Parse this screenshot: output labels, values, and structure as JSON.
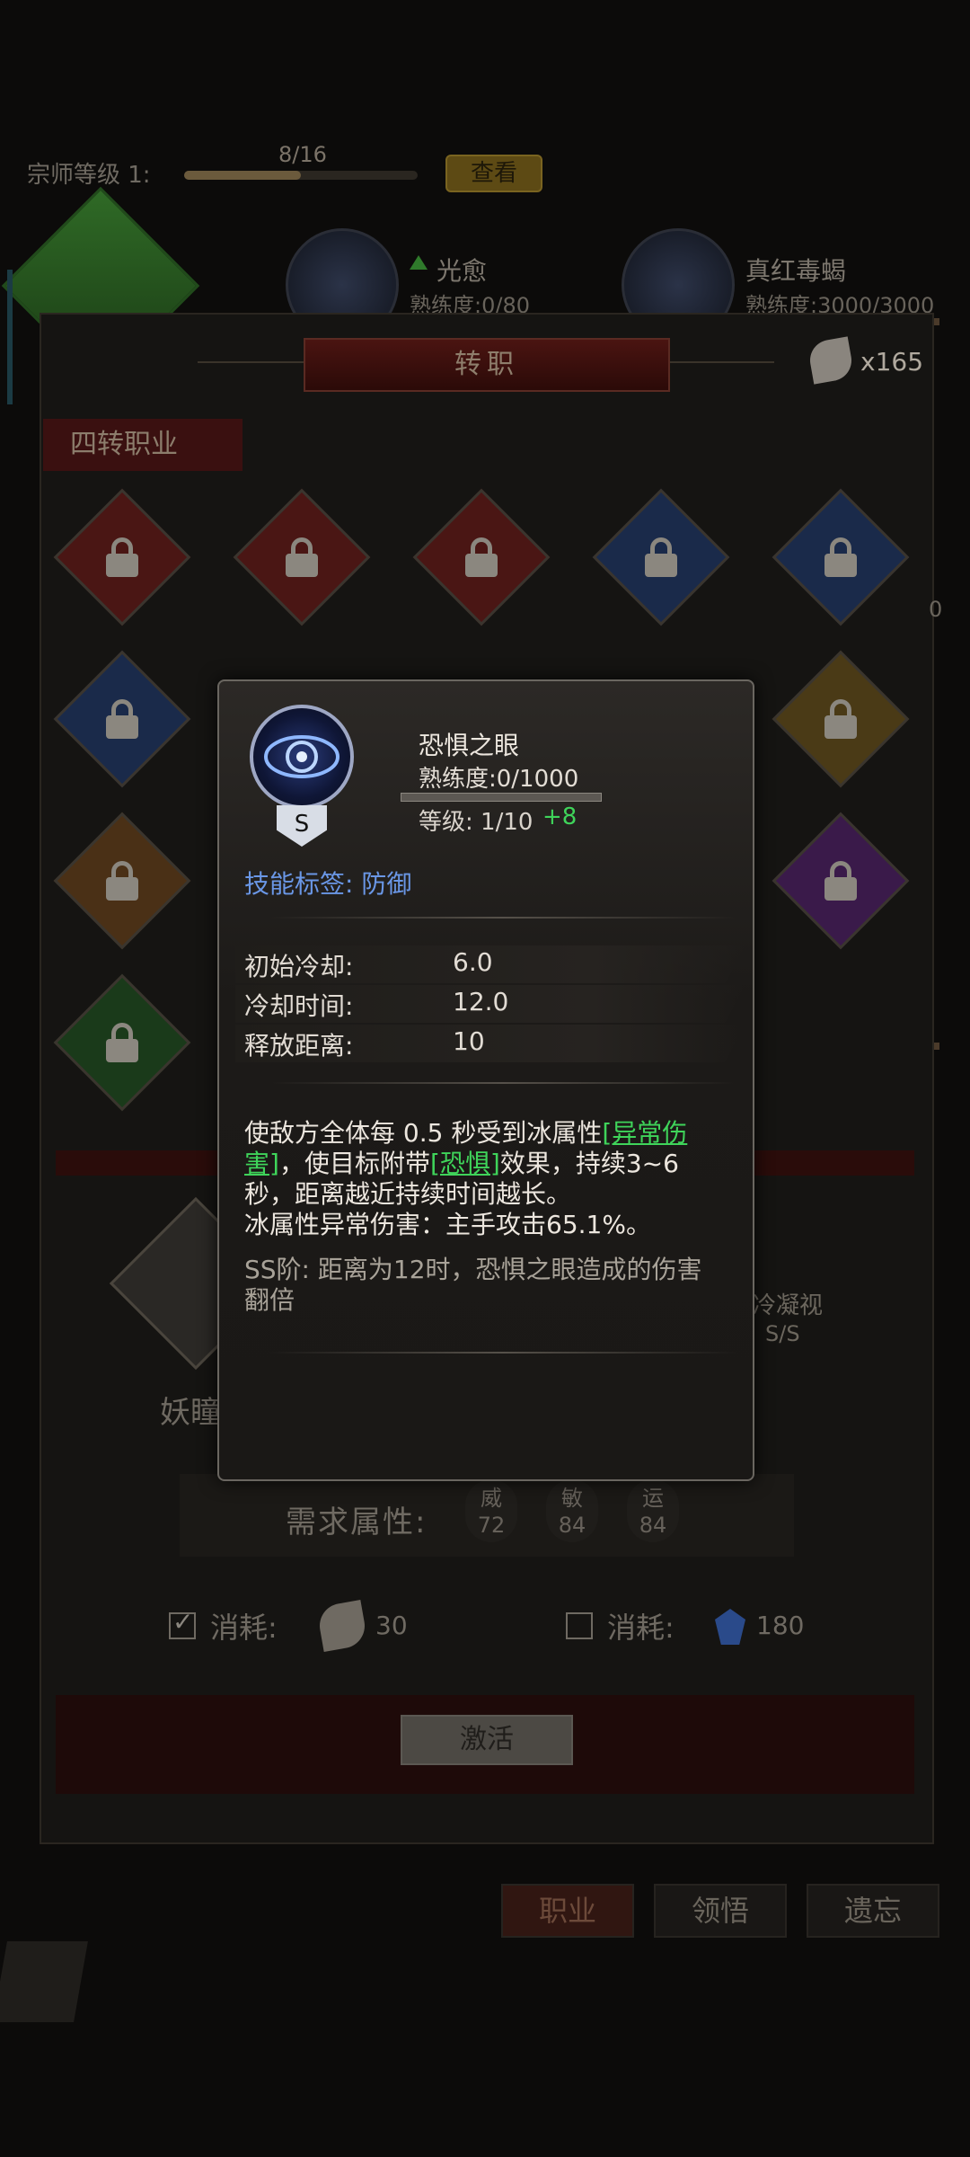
{
  "master": {
    "label": "宗师等级 1:",
    "progress_text": "8/16",
    "progress": 0.5,
    "view_button": "查看"
  },
  "top_skills": [
    {
      "name": "光愈",
      "proficiency": "熟练度:0/80"
    },
    {
      "name": "真红毒蝎",
      "proficiency": "熟练度:3000/3000"
    }
  ],
  "panel": {
    "title": "转职",
    "leaf_count": "x165",
    "section_tab": "四转职业",
    "right_hint": "0"
  },
  "popup": {
    "skill_name": "恐惧之眼",
    "proficiency": "熟练度:0/1000",
    "rank": "S",
    "level": "等级: 1/10",
    "level_bonus": "+8",
    "tag_label": "技能标签:",
    "tag_value": "防御",
    "attributes": [
      {
        "label": "初始冷却:",
        "value": "6.0"
      },
      {
        "label": "冷却时间:",
        "value": "12.0"
      },
      {
        "label": "释放距离:",
        "value": "10"
      }
    ],
    "desc_part1": "使敌方全体每 0.5 秒受到冰属性",
    "desc_hl1": "[异常伤害]",
    "desc_part2": "，使目标附带",
    "desc_hl2": "[恐惧]",
    "desc_part3": "效果，持续3~6 秒，距离越近持续时间越长。",
    "desc_line2": "冰属性异常伤害：主手攻击65.1%。",
    "ss_text": "SS阶: 距离为12时，恐惧之眼造成的伤害翻倍"
  },
  "lower": {
    "name_under": "妖瞳",
    "cold_label": "冷凝视",
    "ss_label": "S/S",
    "req_label": "需求属性:",
    "stats": [
      {
        "name": "威",
        "value": "72"
      },
      {
        "name": "敏",
        "value": "84"
      },
      {
        "name": "运",
        "value": "84"
      }
    ],
    "cost_label": "消耗:",
    "cost1": "30",
    "cost2": "180",
    "cost1_checked": true,
    "cost2_checked": false,
    "activate": "激活"
  },
  "bottom_tabs": [
    {
      "label": "职业",
      "active": true
    },
    {
      "label": "领悟",
      "active": false
    },
    {
      "label": "遗忘",
      "active": false
    }
  ],
  "colors": {
    "green_highlight": "#3fd45a",
    "tag_blue": "#6a97e6"
  }
}
